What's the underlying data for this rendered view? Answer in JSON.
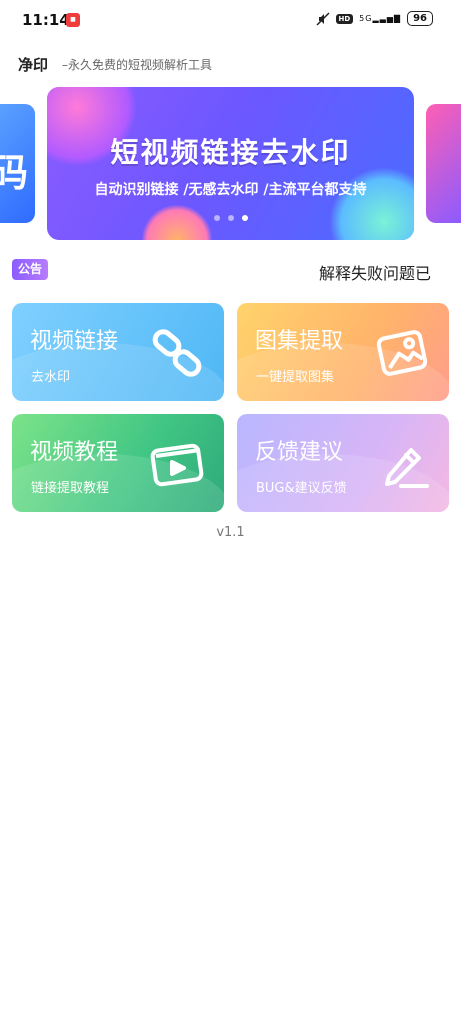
{
  "status_bar": {
    "time": "11:14",
    "hd": "HD",
    "signal": "5G",
    "battery": "96"
  },
  "header": {
    "brand": "净印",
    "slogan": "–永久免费的短视频解析工具"
  },
  "banner": {
    "prev_partial_text": "码",
    "title": "短视频链接去水印",
    "subtitle": "自动识别链接 /无感去水印 /主流平台都支持",
    "dots": 3,
    "active_dot": 3
  },
  "notice": {
    "tag": "公告",
    "text": "解释失败问题已"
  },
  "cards": [
    {
      "title": "视频链接",
      "subtitle": "去水印",
      "icon": "link-icon"
    },
    {
      "title": "图集提取",
      "subtitle": "一键提取图集",
      "icon": "image-icon"
    },
    {
      "title": "视频教程",
      "subtitle": "链接提取教程",
      "icon": "video-play-icon"
    },
    {
      "title": "反馈建议",
      "subtitle": "BUG&建议反馈",
      "icon": "pencil-icon"
    }
  ],
  "version": "v1.1"
}
